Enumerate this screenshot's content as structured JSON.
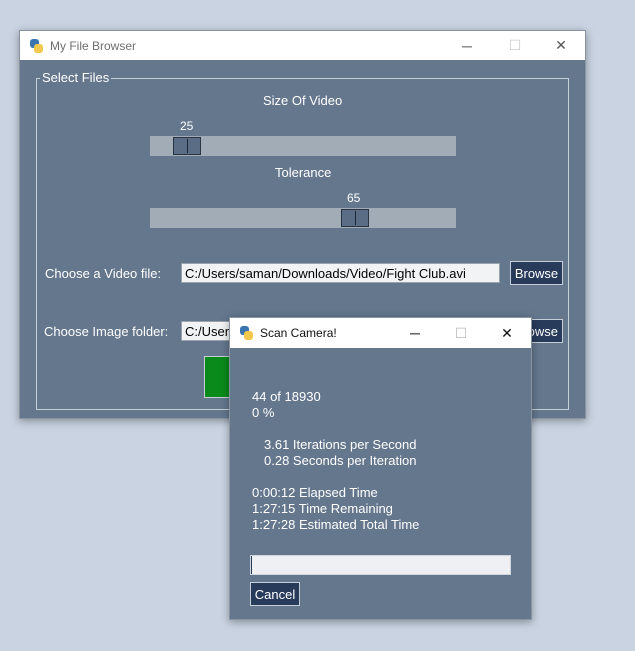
{
  "main_window": {
    "title": "My File Browser",
    "controls": {
      "minimize": "─",
      "maximize": "☐",
      "close": "✕"
    },
    "frame_label": "Select Files",
    "size_slider": {
      "label": "Size Of Video",
      "value": "25"
    },
    "tolerance_slider": {
      "label": "Tolerance",
      "value": "65"
    },
    "video_file": {
      "label": "Choose a Video file:",
      "value": "C:/Users/saman/Downloads/Video/Fight Club.avi",
      "browse_label": "Browse"
    },
    "image_folder": {
      "label": "Choose Image folder:",
      "value": "C:/Users",
      "browse_label": "owse"
    }
  },
  "dialog": {
    "title": "Scan Camera!",
    "controls": {
      "minimize": "─",
      "maximize": "☐",
      "close": "✕"
    },
    "count_line": "44 of 18930",
    "percent_line": "0 %",
    "rate_line": "3.61 Iterations per Second",
    "spi_line": "0.28 Seconds per Iteration",
    "elapsed_line": "0:00:12 Elapsed Time",
    "remaining_line": "1:27:15 Time Remaining",
    "total_line": "1:27:28 Estimated Total Time",
    "progress_fraction": 0.0023,
    "cancel_label": "Cancel"
  },
  "colors": {
    "window_bg": "#64778d",
    "button_bg": "#283b5b",
    "green_button": "#0a8a1a",
    "desktop": "#c9d3e1"
  }
}
